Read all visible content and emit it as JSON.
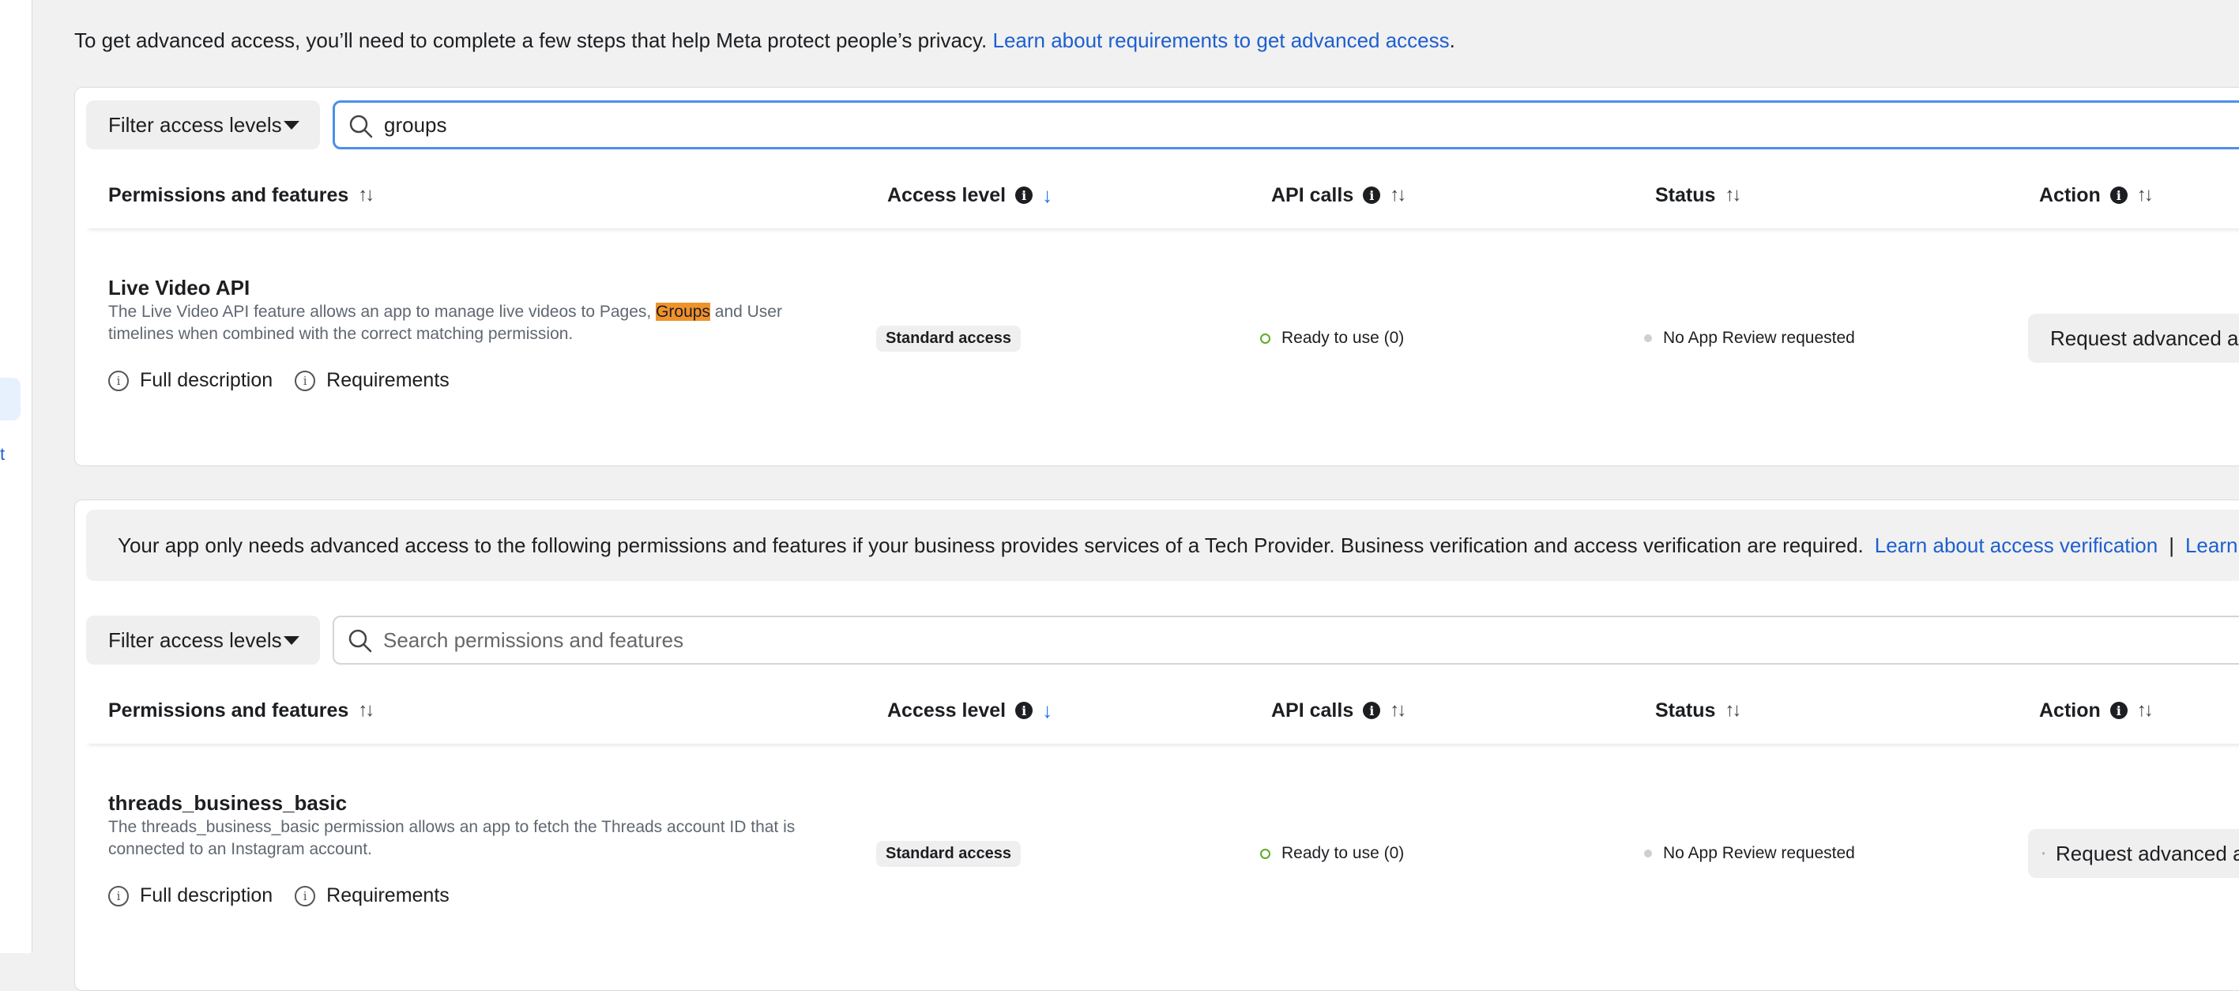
{
  "intro": {
    "text": "To get advanced access, you’ll need to complete a few steps that help Meta protect people’s privacy. ",
    "link": "Learn about requirements to get advanced access",
    "end": "."
  },
  "sidebar": {
    "partial_link": "t"
  },
  "section1": {
    "filter_label": "Filter access levels",
    "search_value": "groups",
    "headers": {
      "permissions": "Permissions and features",
      "access_level": "Access level",
      "api_calls": "API calls",
      "status": "Status",
      "action": "Action"
    },
    "row": {
      "name": "Live Video API",
      "desc_before": "The Live Video API feature allows an app to manage live videos to Pages, ",
      "desc_highlight": "Groups",
      "desc_after": " and User timelines when combined with the correct matching permission.",
      "full_description": "Full description",
      "requirements": "Requirements",
      "access_badge": "Standard access",
      "api_status": "Ready to use (0)",
      "review_status": "No App Review requested",
      "action_label": "Request advanced access"
    }
  },
  "section2": {
    "notice": {
      "text": "Your app only needs advanced access to the following permissions and features if your business provides services of a Tech Provider. Business verification and access verification are required.",
      "link1": "Learn about access verification",
      "separator": "|",
      "link2": "Learn about Tech Providers"
    },
    "filter_label": "Filter access levels",
    "search_placeholder": "Search permissions and features",
    "headers": {
      "permissions": "Permissions and features",
      "access_level": "Access level",
      "api_calls": "API calls",
      "status": "Status",
      "action": "Action"
    },
    "row": {
      "name": "threads_business_basic",
      "desc": "The threads_business_basic permission allows an app to fetch the Threads account ID that is connected to an Instagram account.",
      "full_description": "Full description",
      "requirements": "Requirements",
      "access_badge": "Standard access",
      "api_status": "Ready to use (0)",
      "review_status": "No App Review requested",
      "action_label": "Request advanced access"
    }
  },
  "icons": {
    "sort": "sort-arrows-icon",
    "sort_active": "sort-down-arrow-icon",
    "info": "info-icon",
    "search": "search-icon",
    "shield": "shield-icon",
    "dropdown": "caret-down-icon"
  },
  "colors": {
    "link": "#1d5fcf",
    "highlight": "#f0922c",
    "ready_dot": "#5bac27",
    "sort_active": "#1d6ff0",
    "focus_border": "#4d8fe8"
  }
}
